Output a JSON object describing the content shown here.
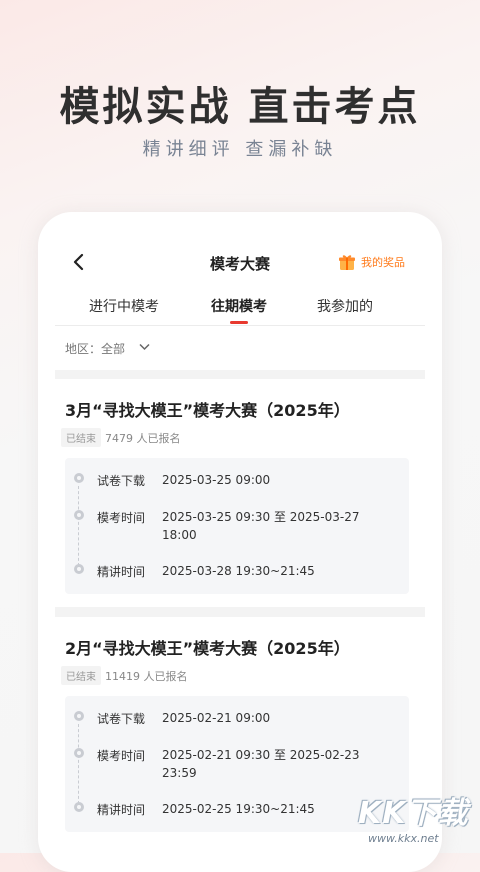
{
  "hero": {
    "title": "模拟实战  直击考点",
    "subtitle": "精讲细评  查漏补缺"
  },
  "navbar": {
    "title": "模考大赛",
    "prize_label": "我的奖品"
  },
  "tabs": [
    {
      "label": "进行中模考",
      "active": false
    },
    {
      "label": "往期模考",
      "active": true
    },
    {
      "label": "我参加的",
      "active": false
    }
  ],
  "filter": {
    "label": "地区：全部"
  },
  "cards": [
    {
      "title": "3月“寻找大模王”模考大赛（2025年）",
      "status": "已结束",
      "signups": "7479 人已报名",
      "timeline": [
        {
          "label": "试卷下载",
          "value": "2025-03-25 09:00"
        },
        {
          "label": "模考时间",
          "value": "2025-03-25 09:30 至 2025-03-27 18:00"
        },
        {
          "label": "精讲时间",
          "value": "2025-03-28 19:30~21:45"
        }
      ]
    },
    {
      "title": "2月“寻找大模王”模考大赛（2025年）",
      "status": "已结束",
      "signups": "11419 人已报名",
      "timeline": [
        {
          "label": "试卷下载",
          "value": "2025-02-21 09:00"
        },
        {
          "label": "模考时间",
          "value": "2025-02-21 09:30 至 2025-02-23 23:59"
        },
        {
          "label": "精讲时间",
          "value": "2025-02-25 19:30~21:45"
        }
      ]
    }
  ],
  "watermark": {
    "text": "KK下载",
    "url": "www.kkx.net"
  },
  "colors": {
    "accent": "#e8392f",
    "prize": "#ff7a1a"
  }
}
